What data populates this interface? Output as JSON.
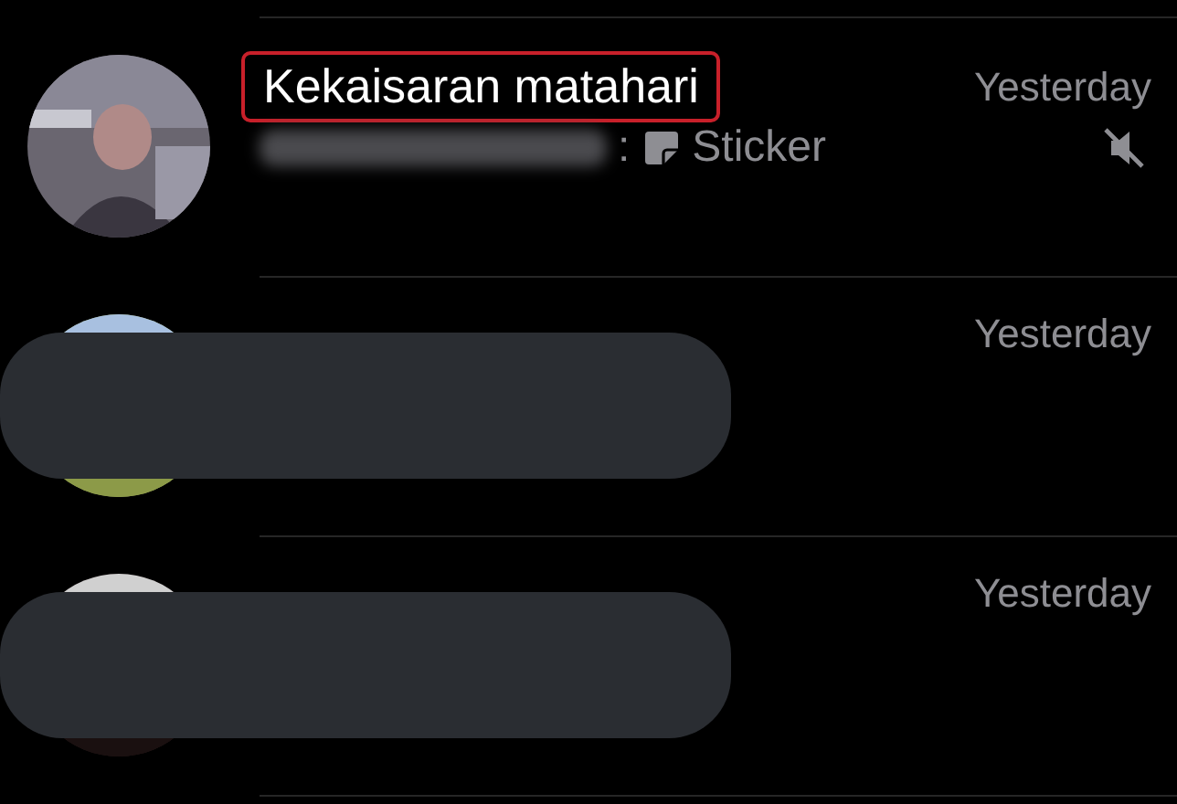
{
  "chats": [
    {
      "name": "Kekaisaran matahari",
      "highlighted": true,
      "time": "Yesterday",
      "muted": true,
      "redacted": false,
      "preview": {
        "sender_blurred": true,
        "prefix": ":",
        "kind": "sticker",
        "text": "Sticker"
      }
    },
    {
      "time": "Yesterday",
      "muted": false,
      "redacted": true
    },
    {
      "time": "Yesterday",
      "muted": false,
      "redacted": true
    }
  ]
}
